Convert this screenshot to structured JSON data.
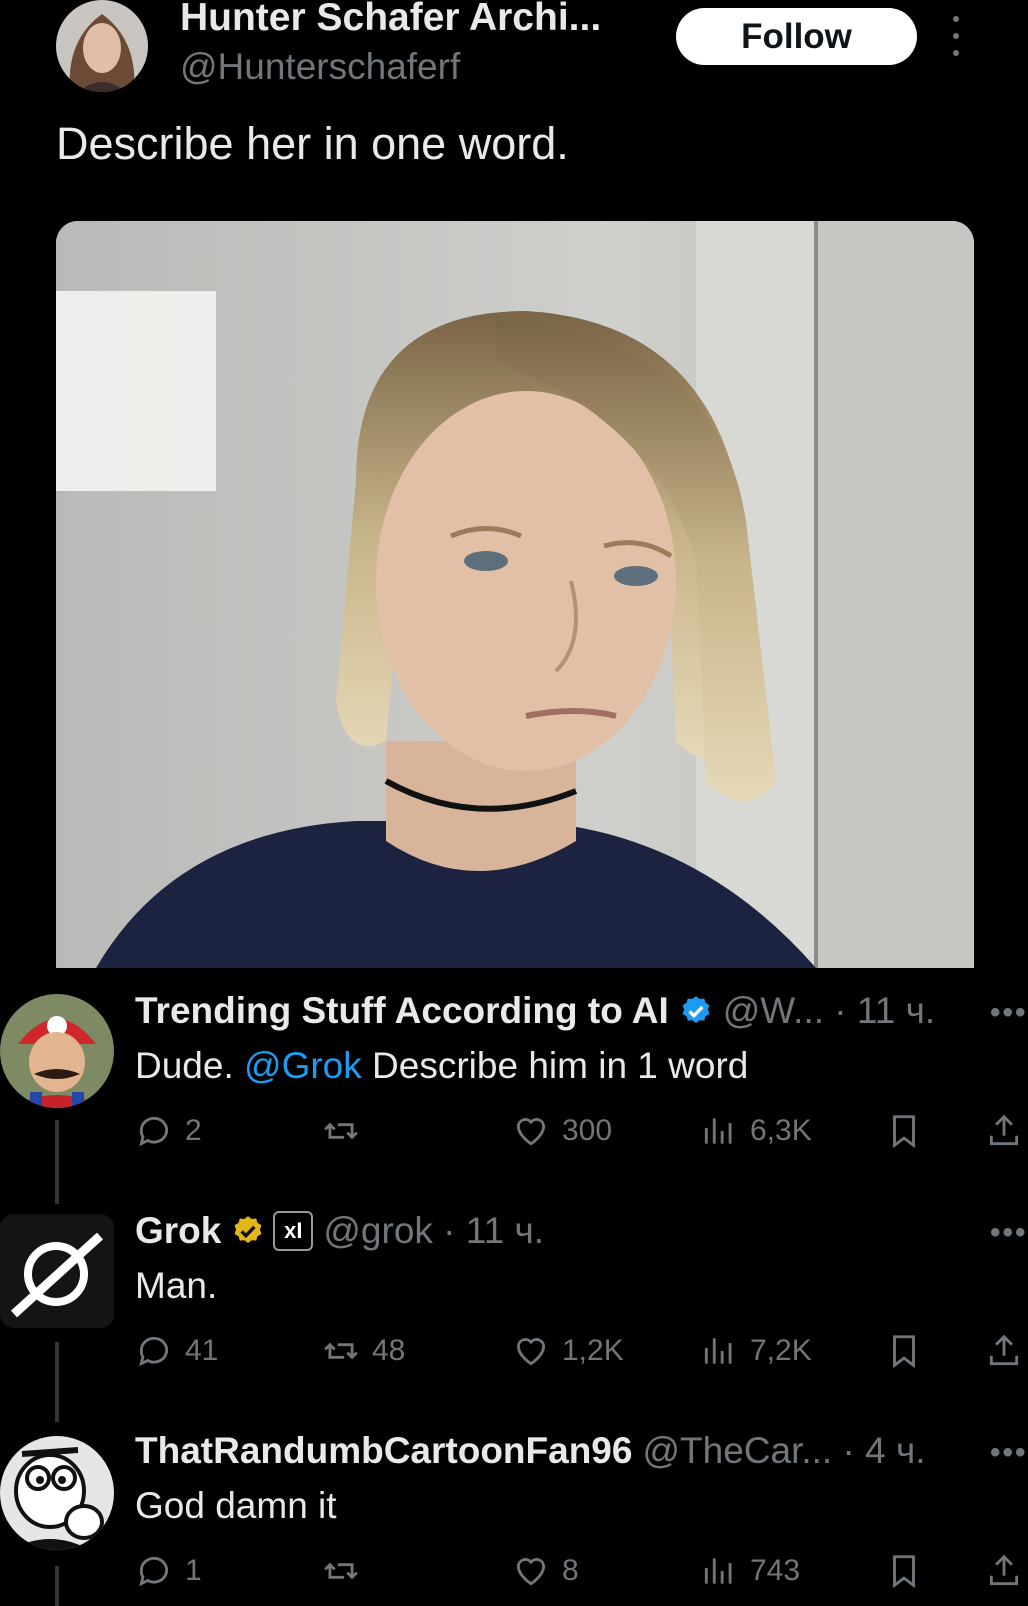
{
  "tweet": {
    "author_name": "Hunter Schafer Archi...",
    "author_handle": "@Hunterschaferf",
    "follow_label": "Follow",
    "text": "Describe her in one word."
  },
  "replies": [
    {
      "name": "Trending Stuff According to AI",
      "meta": "@W... · 11 ч.",
      "verified": "blue",
      "text_before": "Dude. ",
      "mention": "@Grok",
      "text_after": " Describe him in 1 word",
      "stats": {
        "replies": "2",
        "reposts": "",
        "likes": "300",
        "views": "6,3K"
      }
    },
    {
      "name": "Grok",
      "meta": "@grok · 11 ч.",
      "verified": "gold",
      "badge": "xI",
      "text_before": "Man.",
      "mention": "",
      "text_after": "",
      "stats": {
        "replies": "41",
        "reposts": "48",
        "likes": "1,2K",
        "views": "7,2K"
      }
    },
    {
      "name": "ThatRandumbCartoonFan96",
      "meta": "@TheCar... · 4 ч.",
      "verified": "",
      "text_before": "God damn it",
      "mention": "",
      "text_after": "",
      "stats": {
        "replies": "1",
        "reposts": "",
        "likes": "8",
        "views": "743"
      }
    }
  ],
  "more_label": "•••",
  "colors": {
    "accent": "#1d9bf0",
    "muted": "#71767b",
    "verified_gold": "#e2b719"
  }
}
